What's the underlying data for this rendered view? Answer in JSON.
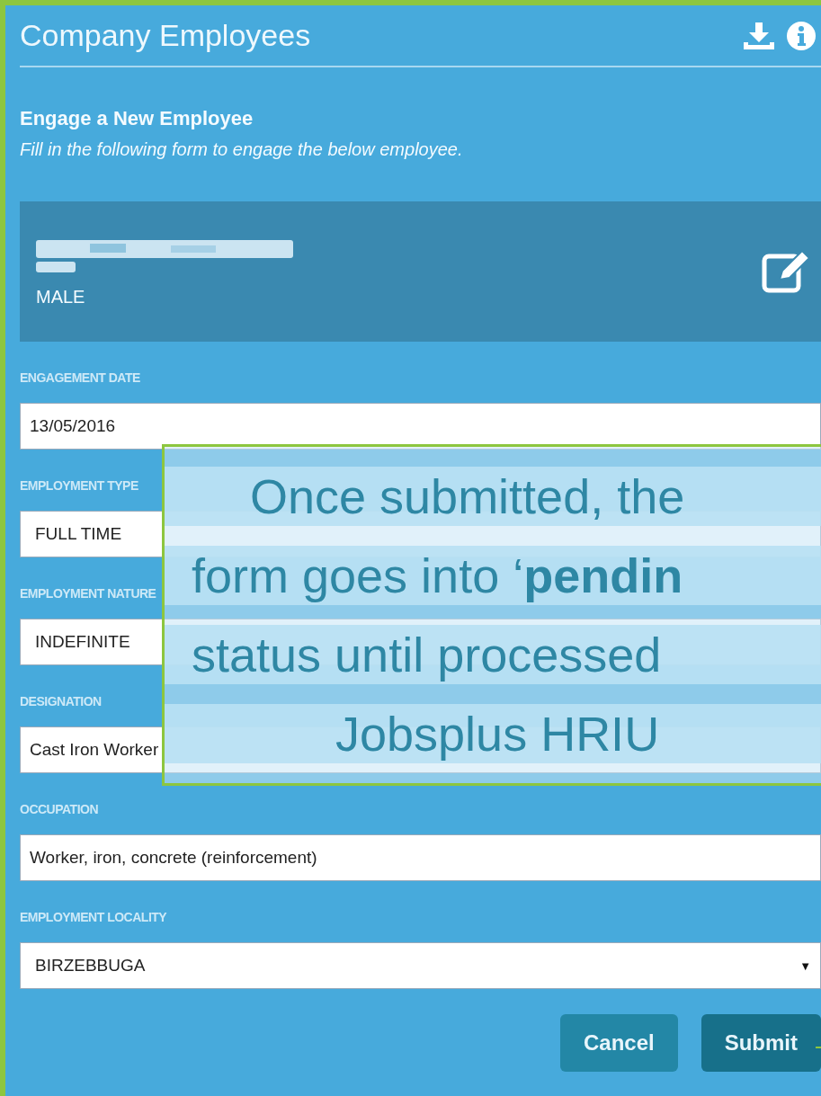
{
  "header": {
    "title": "Company Employees"
  },
  "section": {
    "heading": "Engage a New Employee",
    "subtitle": "Fill in the following form to engage the below employee."
  },
  "employee": {
    "gender": "MALE"
  },
  "fields": [
    {
      "kind": "text",
      "label": "ENGAGEMENT DATE",
      "value": "13/05/2016"
    },
    {
      "kind": "select",
      "label": "EMPLOYMENT TYPE",
      "value": "FULL TIME"
    },
    {
      "kind": "select",
      "label": "EMPLOYMENT NATURE",
      "value": "INDEFINITE"
    },
    {
      "kind": "text",
      "label": "DESIGNATION",
      "value": "Cast Iron Worker"
    },
    {
      "kind": "text",
      "label": "OCCUPATION",
      "value": "Worker, iron, concrete (reinforcement)"
    },
    {
      "kind": "select",
      "label": "EMPLOYMENT LOCALITY",
      "value": "BIRZEBBUGA",
      "caret": "▼"
    }
  ],
  "buttons": [
    {
      "kind": "secondary",
      "label": "Cancel"
    },
    {
      "kind": "primary",
      "label": "Submit"
    }
  ],
  "callout": {
    "lines": [
      "Once submitted, the",
      "form goes into ‘**pendin**",
      "status until processed",
      "Jobsplus HRIU"
    ]
  }
}
